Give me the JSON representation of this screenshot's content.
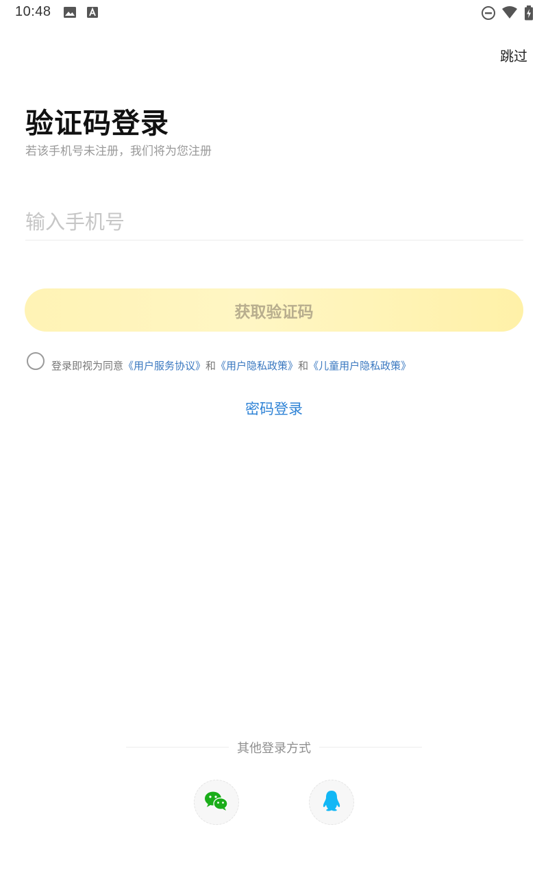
{
  "status_bar": {
    "time": "10:48",
    "icons": [
      "image-icon",
      "keyboard-icon",
      "do-not-disturb-icon",
      "wifi-icon",
      "battery-charging-icon"
    ]
  },
  "header": {
    "skip_label": "跳过"
  },
  "main": {
    "title": "验证码登录",
    "subtitle": "若该手机号未注册，我们将为您注册",
    "phone_input": {
      "value": "",
      "placeholder": "输入手机号"
    },
    "get_code_label": "获取验证码",
    "agreement": {
      "checked": false,
      "prefix": "登录即视为同意",
      "link_user_agreement": "《用户服务协议》",
      "and_1": "和",
      "link_privacy_policy": "《用户隐私政策》",
      "and_2": "和",
      "link_child_privacy": "《儿童用户隐私政策》"
    },
    "password_login_label": "密码登录"
  },
  "other_login": {
    "label": "其他登录方式",
    "methods": [
      {
        "icon": "wechat-icon",
        "color": "#1aad19"
      },
      {
        "icon": "qq-icon",
        "color": "#12b7f5"
      }
    ]
  },
  "colors": {
    "accent_link": "#2f83d6",
    "button_bg": "#fff3b5",
    "button_text": "#b8ae8e"
  }
}
